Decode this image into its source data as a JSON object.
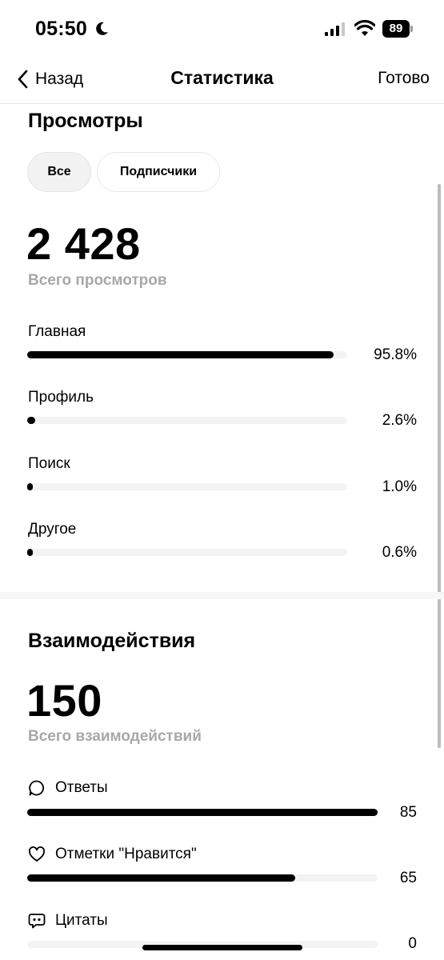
{
  "status_bar": {
    "time": "05:50",
    "battery": "89"
  },
  "nav": {
    "back_label": "Назад",
    "title": "Статистика",
    "done_label": "Готово"
  },
  "views": {
    "title": "Просмотры",
    "filters": [
      "Все",
      "Подписчики"
    ],
    "selected_filter": "Все",
    "total": "2 428",
    "total_label": "Всего просмотров",
    "sources": [
      {
        "label": "Главная",
        "value": "95.8%",
        "fraction": 0.958
      },
      {
        "label": "Профиль",
        "value": "2.6%",
        "fraction": 0.026
      },
      {
        "label": "Поиск",
        "value": "1.0%",
        "fraction": 0.01
      },
      {
        "label": "Другое",
        "value": "0.6%",
        "fraction": 0.006
      }
    ]
  },
  "interactions": {
    "title": "Взаимодействия",
    "total": "150",
    "total_label": "Всего взаимодействий",
    "items": [
      {
        "icon": "comment-icon",
        "label": "Ответы",
        "value": "85",
        "fraction": 1.0
      },
      {
        "icon": "heart-icon",
        "label": "Отметки \"Нравится\"",
        "value": "65",
        "fraction": 0.765
      },
      {
        "icon": "quote-icon",
        "label": "Цитаты",
        "value": "0",
        "fraction": 0.0
      }
    ]
  },
  "colors": {
    "accent": "#000000",
    "track": "#f3f3f3",
    "muted_text": "#a8a8a8"
  }
}
